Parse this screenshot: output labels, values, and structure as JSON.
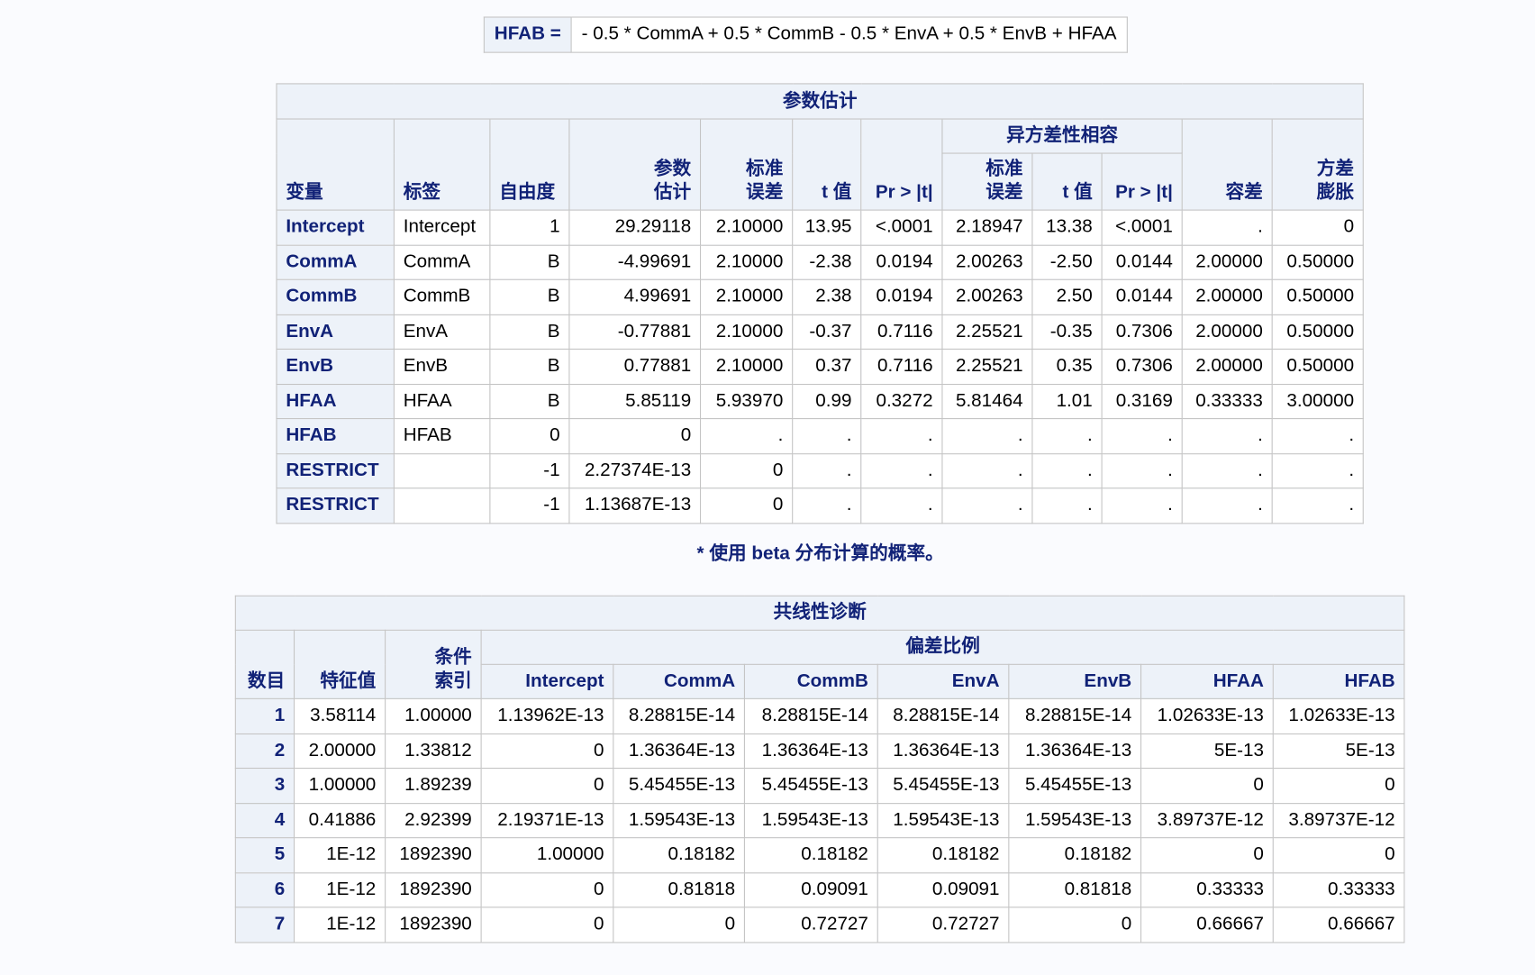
{
  "restriction": {
    "label": "HFAB =",
    "expr": "- 0.5 * CommA + 0.5 * CommB - 0.5 * EnvA + 0.5 * EnvB + HFAA"
  },
  "param_est": {
    "title": "参数估计",
    "group": "异方差性相容",
    "headers": [
      "变量",
      "标签",
      "自由度",
      "参数\n估计",
      "标准\n误差",
      "t 值",
      "Pr > |t|",
      "标准\n误差",
      "t 值",
      "Pr > |t|",
      "容差",
      "方差\n膨胀"
    ],
    "rows": [
      [
        "Intercept",
        "Intercept",
        "1",
        "29.29118",
        "2.10000",
        "13.95",
        "<.0001",
        "2.18947",
        "13.38",
        "<.0001",
        ".",
        "0"
      ],
      [
        "CommA",
        "CommA",
        "B",
        "-4.99691",
        "2.10000",
        "-2.38",
        "0.0194",
        "2.00263",
        "-2.50",
        "0.0144",
        "2.00000",
        "0.50000"
      ],
      [
        "CommB",
        "CommB",
        "B",
        "4.99691",
        "2.10000",
        "2.38",
        "0.0194",
        "2.00263",
        "2.50",
        "0.0144",
        "2.00000",
        "0.50000"
      ],
      [
        "EnvA",
        "EnvA",
        "B",
        "-0.77881",
        "2.10000",
        "-0.37",
        "0.7116",
        "2.25521",
        "-0.35",
        "0.7306",
        "2.00000",
        "0.50000"
      ],
      [
        "EnvB",
        "EnvB",
        "B",
        "0.77881",
        "2.10000",
        "0.37",
        "0.7116",
        "2.25521",
        "0.35",
        "0.7306",
        "2.00000",
        "0.50000"
      ],
      [
        "HFAA",
        "HFAA",
        "B",
        "5.85119",
        "5.93970",
        "0.99",
        "0.3272",
        "5.81464",
        "1.01",
        "0.3169",
        "0.33333",
        "3.00000"
      ],
      [
        "HFAB",
        "HFAB",
        "0",
        "0",
        ".",
        ".",
        ".",
        ".",
        ".",
        ".",
        ".",
        "."
      ],
      [
        "RESTRICT",
        "",
        "-1",
        "2.27374E-13",
        "0",
        ".",
        ".",
        ".",
        ".",
        ".",
        ".",
        "."
      ],
      [
        "RESTRICT",
        "",
        "-1",
        "1.13687E-13",
        "0",
        ".",
        ".",
        ".",
        ".",
        ".",
        ".",
        "."
      ]
    ]
  },
  "footnote": "* 使用 beta 分布计算的概率。",
  "collin": {
    "title": "共线性诊断",
    "group": "偏差比例",
    "headers": [
      "数目",
      "特征值",
      "条件\n索引",
      "Intercept",
      "CommA",
      "CommB",
      "EnvA",
      "EnvB",
      "HFAA",
      "HFAB"
    ],
    "rows": [
      [
        "1",
        "3.58114",
        "1.00000",
        "1.13962E-13",
        "8.28815E-14",
        "8.28815E-14",
        "8.28815E-14",
        "8.28815E-14",
        "1.02633E-13",
        "1.02633E-13"
      ],
      [
        "2",
        "2.00000",
        "1.33812",
        "0",
        "1.36364E-13",
        "1.36364E-13",
        "1.36364E-13",
        "1.36364E-13",
        "5E-13",
        "5E-13"
      ],
      [
        "3",
        "1.00000",
        "1.89239",
        "0",
        "5.45455E-13",
        "5.45455E-13",
        "5.45455E-13",
        "5.45455E-13",
        "0",
        "0"
      ],
      [
        "4",
        "0.41886",
        "2.92399",
        "2.19371E-13",
        "1.59543E-13",
        "1.59543E-13",
        "1.59543E-13",
        "1.59543E-13",
        "3.89737E-12",
        "3.89737E-12"
      ],
      [
        "5",
        "1E-12",
        "1892390",
        "1.00000",
        "0.18182",
        "0.18182",
        "0.18182",
        "0.18182",
        "0",
        "0"
      ],
      [
        "6",
        "1E-12",
        "1892390",
        "0",
        "0.81818",
        "0.09091",
        "0.09091",
        "0.81818",
        "0.33333",
        "0.33333"
      ],
      [
        "7",
        "1E-12",
        "1892390",
        "0",
        "0",
        "0.72727",
        "0.72727",
        "0",
        "0.66667",
        "0.66667"
      ]
    ]
  }
}
